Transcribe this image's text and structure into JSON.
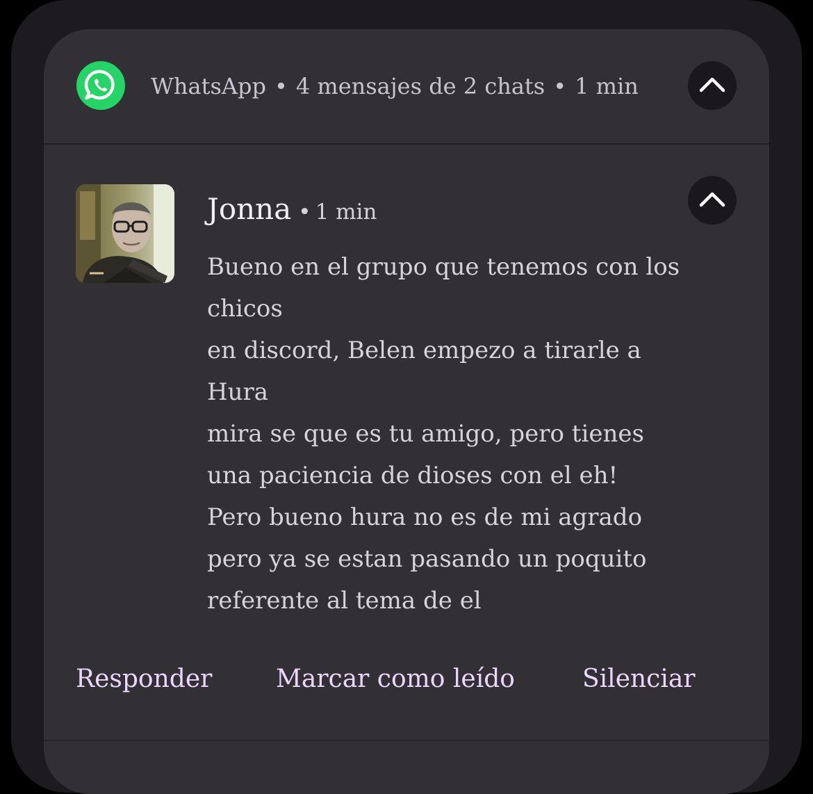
{
  "notification": {
    "app_name": "WhatsApp",
    "summary": "4 mensajes de 2 chats",
    "time": "1 min",
    "separator": "•",
    "app_icon": "whatsapp-icon",
    "expand_icon": "chevron-up-icon",
    "colors": {
      "card_bg": "#323035",
      "whatsapp_green": "#25d366",
      "action_text": "#ecd6fb"
    }
  },
  "message": {
    "sender": "Jonna",
    "separator": "•",
    "time": "1 min",
    "lines": [
      "Bueno en el grupo que tenemos con los",
      "chicos",
      "en discord, Belen empezo a tirarle a",
      "Hura",
      "mira se que es tu amigo, pero tienes",
      "una paciencia de dioses con el eh!",
      "Pero bueno hura no es de mi agrado",
      "pero ya se estan pasando un poquito",
      "referente al tema de el"
    ]
  },
  "actions": {
    "reply": "Responder",
    "mark_read": "Marcar como leído",
    "mute": "Silenciar"
  }
}
